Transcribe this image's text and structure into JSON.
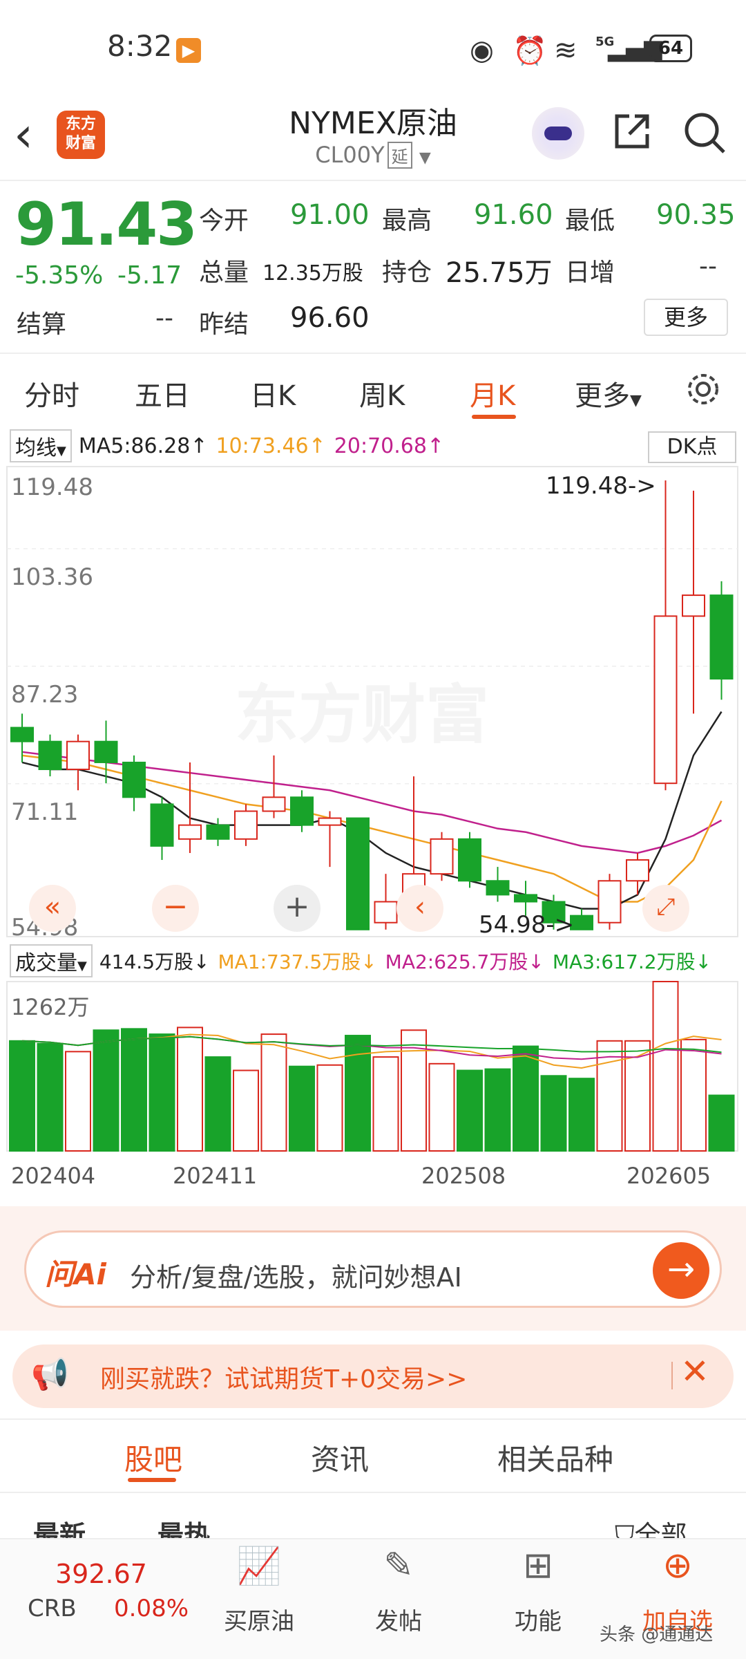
{
  "status": {
    "time": "8:32",
    "battery": "64",
    "signal": "5G"
  },
  "header": {
    "title": "NYMEX原油",
    "code": "CL00Y",
    "tag": "延",
    "logo": "东方\n财富"
  },
  "quote": {
    "price": "91.43",
    "pct": "-5.35%",
    "chg": "-5.17",
    "open_label": "今开",
    "open": "91.00",
    "high_label": "最高",
    "high": "91.60",
    "low_label": "最低",
    "low": "90.35",
    "vol_label": "总量",
    "vol": "12.35万股",
    "oi_label": "持仓",
    "oi": "25.75万",
    "daily_label": "日增",
    "daily": "--",
    "settle_label": "结算",
    "settle": "--",
    "prev_label": "昨结",
    "prev": "96.60",
    "more": "更多"
  },
  "tabs": [
    "分时",
    "五日",
    "日K",
    "周K",
    "月K",
    "更多"
  ],
  "active_tab": "月K",
  "ma": {
    "select": "均线",
    "ma5": "MA5:86.28↑",
    "ma10": "10:73.46↑",
    "ma20": "20:70.68↑",
    "dk": "DK点"
  },
  "vol_indicator": {
    "select": "成交量",
    "v": "414.5万股↓",
    "ma1": "MA1:737.5万股↓",
    "ma2": "MA2:625.7万股↓",
    "ma3": "MA3:617.2万股↓",
    "top": "1262万"
  },
  "chart_data": {
    "type": "candlestick",
    "y_ticks": [
      "119.48",
      "103.36",
      "87.23",
      "71.11",
      "54.98"
    ],
    "ylim": [
      54.98,
      119.48
    ],
    "max_annotation": "119.48->",
    "min_annotation": "54.98->",
    "x_ticks": [
      "202404",
      "202411",
      "202508",
      "202605"
    ],
    "candles": [
      {
        "o": 84,
        "c": 82,
        "h": 86,
        "l": 79,
        "up": false
      },
      {
        "o": 82,
        "c": 78,
        "h": 83,
        "l": 77,
        "up": false
      },
      {
        "o": 78,
        "c": 82,
        "h": 83,
        "l": 75,
        "up": true
      },
      {
        "o": 82,
        "c": 79,
        "h": 85,
        "l": 76,
        "up": false
      },
      {
        "o": 79,
        "c": 74,
        "h": 80,
        "l": 72,
        "up": false
      },
      {
        "o": 73,
        "c": 67,
        "h": 74,
        "l": 65,
        "up": false
      },
      {
        "o": 68,
        "c": 70,
        "h": 79,
        "l": 66,
        "up": true
      },
      {
        "o": 70,
        "c": 68,
        "h": 71,
        "l": 67,
        "up": false
      },
      {
        "o": 68,
        "c": 72,
        "h": 73,
        "l": 67,
        "up": true
      },
      {
        "o": 72,
        "c": 74,
        "h": 80,
        "l": 71,
        "up": true
      },
      {
        "o": 74,
        "c": 70,
        "h": 75,
        "l": 69,
        "up": false
      },
      {
        "o": 70,
        "c": 71,
        "h": 72,
        "l": 64,
        "up": true
      },
      {
        "o": 71,
        "c": 55,
        "h": 71,
        "l": 55,
        "up": false
      },
      {
        "o": 56,
        "c": 59,
        "h": 63,
        "l": 55,
        "up": true
      },
      {
        "o": 59,
        "c": 63,
        "h": 77,
        "l": 58,
        "up": true
      },
      {
        "o": 63,
        "c": 68,
        "h": 69,
        "l": 62,
        "up": true
      },
      {
        "o": 68,
        "c": 62,
        "h": 69,
        "l": 61,
        "up": false
      },
      {
        "o": 62,
        "c": 60,
        "h": 64,
        "l": 59,
        "up": false
      },
      {
        "o": 60,
        "c": 59,
        "h": 62,
        "l": 57,
        "up": false
      },
      {
        "o": 59,
        "c": 56,
        "h": 60,
        "l": 55,
        "up": false
      },
      {
        "o": 57,
        "c": 55,
        "h": 58,
        "l": 54.98,
        "up": false
      },
      {
        "o": 56,
        "c": 62,
        "h": 63,
        "l": 55,
        "up": true
      },
      {
        "o": 62,
        "c": 65,
        "h": 66,
        "l": 60,
        "up": true
      },
      {
        "o": 76,
        "c": 100,
        "h": 119.48,
        "l": 75,
        "up": true
      },
      {
        "o": 100,
        "c": 103,
        "h": 118,
        "l": 86,
        "up": true
      },
      {
        "o": 103,
        "c": 91,
        "h": 105,
        "l": 88,
        "up": false
      }
    ],
    "ma5": [
      79,
      78,
      78,
      77,
      76,
      74,
      71,
      70,
      70,
      70,
      70,
      71,
      69,
      66,
      64,
      63,
      62,
      61,
      60,
      59,
      58,
      58,
      60,
      68,
      80,
      86.28
    ],
    "ma10": [
      80,
      79.5,
      79,
      78,
      77,
      76,
      75,
      74,
      73,
      72.5,
      72,
      71,
      70,
      69,
      68,
      67,
      66,
      65,
      64,
      63,
      61,
      59,
      59,
      61,
      65,
      73.46
    ],
    "ma20": [
      80.5,
      80,
      79.5,
      79,
      78.5,
      78,
      77.5,
      77,
      76.5,
      76,
      75.5,
      75,
      74,
      73,
      72,
      71.5,
      70.5,
      69.5,
      69,
      68,
      67,
      66.5,
      66,
      67,
      68.5,
      70.68
    ],
    "volume": [
      {
        "v": 820,
        "up": false
      },
      {
        "v": 800,
        "up": false
      },
      {
        "v": 740,
        "up": true
      },
      {
        "v": 900,
        "up": false
      },
      {
        "v": 910,
        "up": false
      },
      {
        "v": 870,
        "up": false
      },
      {
        "v": 920,
        "up": true
      },
      {
        "v": 700,
        "up": false
      },
      {
        "v": 600,
        "up": true
      },
      {
        "v": 870,
        "up": true
      },
      {
        "v": 630,
        "up": false
      },
      {
        "v": 640,
        "up": true
      },
      {
        "v": 860,
        "up": false
      },
      {
        "v": 700,
        "up": true
      },
      {
        "v": 900,
        "up": true
      },
      {
        "v": 650,
        "up": true
      },
      {
        "v": 600,
        "up": false
      },
      {
        "v": 610,
        "up": false
      },
      {
        "v": 780,
        "up": false
      },
      {
        "v": 560,
        "up": false
      },
      {
        "v": 540,
        "up": false
      },
      {
        "v": 820,
        "up": true
      },
      {
        "v": 820,
        "up": true
      },
      {
        "v": 1262,
        "up": true
      },
      {
        "v": 830,
        "up": true
      },
      {
        "v": 414.5,
        "up": false
      }
    ],
    "vol_max": 1262
  },
  "ai": {
    "logo": "问Ai",
    "text": "分析/复盘/选股，就问妙想AI"
  },
  "promo": {
    "text": "刚买就跌？试试期货T+0交易>>"
  },
  "forum_tabs": [
    "股吧",
    "资讯",
    "相关品种"
  ],
  "forum_sub": [
    "最新",
    "最热",
    "全部"
  ],
  "nav": {
    "crb_value": "392.67",
    "crb_name": "CRB",
    "crb_pct": "0.08%",
    "items": [
      "买原油",
      "发帖",
      "功能",
      "加自选"
    ]
  },
  "watermark": "头条 @通通达",
  "colors": {
    "up": "#d9261c",
    "down": "#18a32a",
    "accent": "#e8541e",
    "ma5": "#222222",
    "ma10": "#f0a020",
    "ma20": "#c0208c"
  }
}
